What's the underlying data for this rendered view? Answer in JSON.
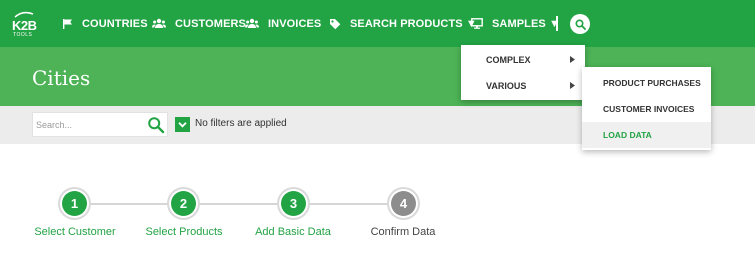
{
  "brand": {
    "logo_text": "K2B",
    "logo_subtext": "TOOLS"
  },
  "nav": {
    "countries": "COUNTRIES",
    "customers": "CUSTOMERS",
    "invoices": "INVOICES",
    "search_products": "SEARCH PRODUCTS ▼",
    "samples": "SAMPLES ▼"
  },
  "page": {
    "title": "Cities"
  },
  "filter": {
    "search_placeholder": "Search...",
    "status": "No filters are applied"
  },
  "steps": [
    {
      "number": "1",
      "label": "Select Customer",
      "state": "done"
    },
    {
      "number": "2",
      "label": "Select Products",
      "state": "done"
    },
    {
      "number": "3",
      "label": "Add Basic Data",
      "state": "done"
    },
    {
      "number": "4",
      "label": "Confirm Data",
      "state": "pending"
    }
  ],
  "samples_menu": {
    "items": [
      {
        "label": "COMPLEX"
      },
      {
        "label": "VARIOUS"
      }
    ]
  },
  "various_submenu": {
    "items": [
      {
        "label": "PRODUCT PURCHASES"
      },
      {
        "label": "CUSTOMER INVOICES"
      },
      {
        "label": "LOAD DATA"
      }
    ],
    "active_label": "LOAD DATA"
  },
  "colors": {
    "primary": "#22a344",
    "title_band": "#4db356",
    "filter_bar": "#ececec",
    "step_pending": "#8d8d8d"
  },
  "icons": {
    "countries": "flag-icon",
    "customers": "users-icon",
    "invoices": "users-icon",
    "search_products": "tag-icon",
    "samples": "monitor-icon",
    "search": "search-icon",
    "filter": "check-icon"
  }
}
